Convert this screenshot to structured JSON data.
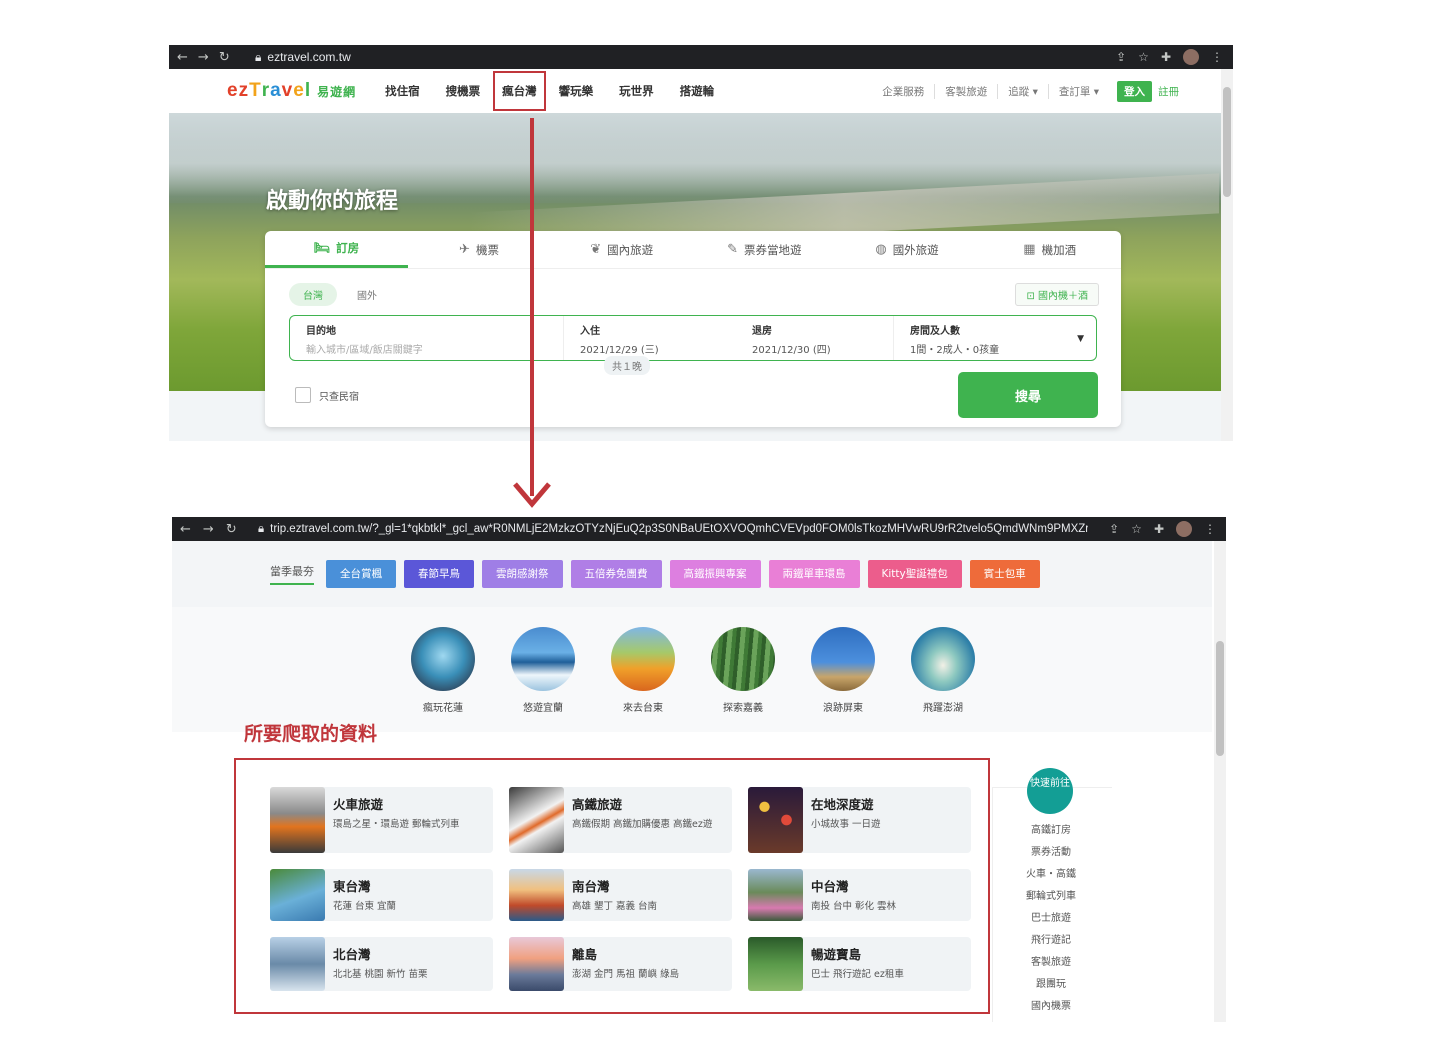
{
  "top": {
    "url": "eztravel.com.tw",
    "logo": "ezTravel",
    "logo_zh": "易遊網",
    "nav": [
      "找住宿",
      "搜機票",
      "瘋台灣",
      "響玩樂",
      "玩世界",
      "搭遊輪"
    ],
    "nav_highlight_index": 2,
    "subnav": [
      "企業服務",
      "客製旅遊",
      "追蹤 ▾",
      "查訂單 ▾"
    ],
    "login": "登入",
    "register": "註冊",
    "hero_title": "啟動你的旅程",
    "tabs": [
      {
        "icon": "bed-icon",
        "label": "訂房"
      },
      {
        "icon": "plane-icon",
        "label": "機票"
      },
      {
        "icon": "leaf-icon",
        "label": "國內旅遊"
      },
      {
        "icon": "ticket-icon",
        "label": "票券當地遊"
      },
      {
        "icon": "globe-icon",
        "label": "國外旅遊"
      },
      {
        "icon": "hotel-icon",
        "label": "機加酒"
      }
    ],
    "region_tabs": [
      "台灣",
      "國外"
    ],
    "combo_link": "國內機＋酒",
    "destination_label": "目的地",
    "destination_placeholder": "輸入城市/區域/飯店關鍵字",
    "checkin_label": "入住",
    "checkin_value": "2021/12/29 (三)",
    "nights": "共１晚",
    "checkout_label": "退房",
    "checkout_value": "2021/12/30 (四)",
    "rooms_label": "房間及人數",
    "rooms_value": "1間・2成人・0孩童",
    "homestay_label": "只查民宿",
    "search_button": "搜尋",
    "accent_color": "#3fb34f"
  },
  "bottom": {
    "url": "trip.eztravel.com.tw/?_gl=1*qkbtkl*_gcl_aw*R0NMLjE2MzkzOTYzNjEuQ2p3S0NBaUEtOXVOQmhCVEVpd0FOM0lsTkozMHVwRU9rR2tvelo5QmdWNm9PMXZrc...",
    "season_label": "當季最夯",
    "chips": [
      {
        "label": "全台賞楓",
        "color": "#4a90d9"
      },
      {
        "label": "春節早鳥",
        "color": "#5b57d8"
      },
      {
        "label": "雲朗感謝祭",
        "color": "#9f7ee6"
      },
      {
        "label": "五倍券免團費",
        "color": "#b07ee6"
      },
      {
        "label": "高鐵振興專案",
        "color": "#dd7fe0"
      },
      {
        "label": "兩鐵單車環島",
        "color": "#e97fd6"
      },
      {
        "label": "Kitty聖誕禮包",
        "color": "#ec5d8c"
      },
      {
        "label": "賓士包車",
        "color": "#ee6b3a"
      }
    ],
    "circles": [
      "瘋玩花蓮",
      "悠遊宜蘭",
      "來去台東",
      "探索嘉義",
      "浪跡屏東",
      "飛躍澎湖"
    ],
    "target_label": "所要爬取的資料",
    "products": [
      {
        "title": "火車旅遊",
        "sub": "環島之星・環島遊 郵輪式列車"
      },
      {
        "title": "高鐵旅遊",
        "sub": "高鐵假期 高鐵加購優惠 高鐵ez遊"
      },
      {
        "title": "在地深度遊",
        "sub": "小城故事 一日遊"
      },
      {
        "title": "東台灣",
        "sub": "花蓮 台東 宜蘭"
      },
      {
        "title": "南台灣",
        "sub": "高雄 墾丁 嘉義 台南"
      },
      {
        "title": "中台灣",
        "sub": "南投 台中 彰化 雲林"
      },
      {
        "title": "北台灣",
        "sub": "北北基 桃園 新竹 苗栗"
      },
      {
        "title": "離島",
        "sub": "澎湖 金門 馬祖 蘭嶼 綠島"
      },
      {
        "title": "暢遊寶島",
        "sub": "巴士 飛行遊記 ez租車"
      }
    ],
    "quick_badge": "快速前往",
    "quick_links": [
      "高鐵訂房",
      "票券活動",
      "火車・高鐵",
      "郵輪式列車",
      "巴士旅遊",
      "飛行遊記",
      "客製旅遊",
      "跟團玩",
      "國內機票"
    ]
  }
}
